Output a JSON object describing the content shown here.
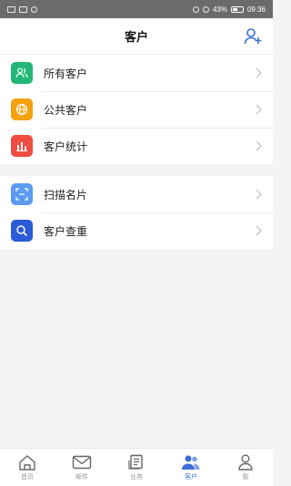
{
  "status_bar": {
    "battery": "43%",
    "time": "09:36"
  },
  "header": {
    "title": "客户"
  },
  "menu_group_1": [
    {
      "label": "所有客户",
      "icon": "people-icon",
      "color": "#22b776"
    },
    {
      "label": "公共客户",
      "icon": "globe-icon",
      "color": "#f5a20f"
    },
    {
      "label": "客户统计",
      "icon": "bar-chart-icon",
      "color": "#ef4c42"
    }
  ],
  "menu_group_2": [
    {
      "label": "扫描名片",
      "icon": "scan-icon",
      "color": "#5b9cf2"
    },
    {
      "label": "客户查重",
      "icon": "search-icon",
      "color": "#2c5bd8"
    }
  ],
  "tabbar": [
    {
      "label": "首页",
      "icon": "home-icon",
      "active": false
    },
    {
      "label": "邮件",
      "icon": "mail-icon",
      "active": false
    },
    {
      "label": "业务",
      "icon": "briefcase-icon",
      "active": false
    },
    {
      "label": "客户",
      "icon": "customers-icon",
      "active": true
    },
    {
      "label": "我",
      "icon": "profile-icon",
      "active": false
    }
  ],
  "colors": {
    "accent": "#3f6fd6",
    "status_bar": "#6b6b6b"
  }
}
